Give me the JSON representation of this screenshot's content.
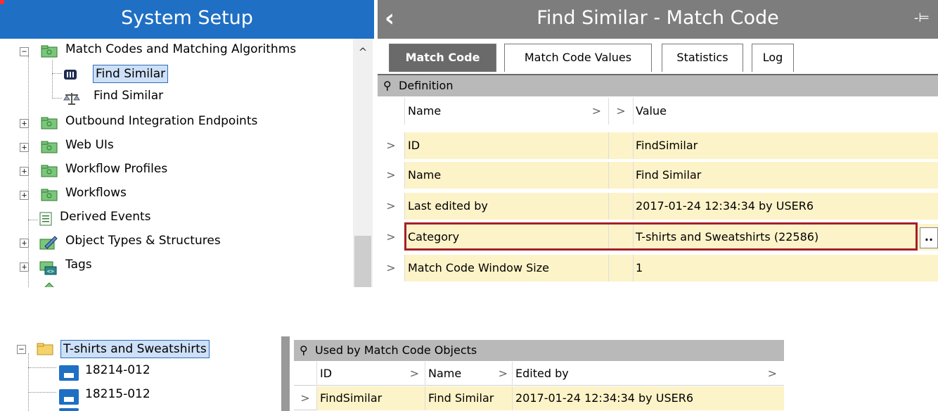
{
  "left_panel": {
    "title": "System Setup",
    "tree": [
      {
        "label": "Match Codes and Matching Algorithms",
        "icon": "folder-icon",
        "expander": "−"
      },
      {
        "label": "Find Similar",
        "icon": "match-code-icon",
        "selected": true
      },
      {
        "label": "Find Similar",
        "icon": "matching-algorithm-icon"
      },
      {
        "label": "Outbound Integration Endpoints",
        "icon": "folder-icon",
        "expander": "+"
      },
      {
        "label": "Web UIs",
        "icon": "folder-icon",
        "expander": "+"
      },
      {
        "label": "Workflow Profiles",
        "icon": "folder-icon",
        "expander": "+"
      },
      {
        "label": "Workflows",
        "icon": "folder-icon",
        "expander": "+"
      },
      {
        "label": "Derived Events",
        "icon": "document-icon"
      },
      {
        "label": "Object Types & Structures",
        "icon": "object-types-icon",
        "expander": "+"
      },
      {
        "label": "Tags",
        "icon": "tags-icon",
        "expander": "+"
      }
    ]
  },
  "right_panel": {
    "title": "Find Similar - Match Code",
    "tabs": [
      {
        "label": "Match Code",
        "active": true
      },
      {
        "label": "Match Code Values"
      },
      {
        "label": "Statistics"
      },
      {
        "label": "Log"
      }
    ],
    "section_title": "Definition",
    "columns": {
      "name": "Name",
      "value": "Value"
    },
    "rows": [
      {
        "name": "ID",
        "value": "FindSimilar"
      },
      {
        "name": "Name",
        "value": "Find Similar"
      },
      {
        "name": "Last edited by",
        "value": "2017-01-24 12:34:34 by USER6"
      },
      {
        "name": "Category",
        "value": "T-shirts and Sweatshirts (22586)"
      },
      {
        "name": "Match Code Window Size",
        "value": "1"
      }
    ],
    "ellipsis_label": ".."
  },
  "bottom_tree": {
    "root": "T-shirts and Sweatshirts",
    "children": [
      "18214-012",
      "18215-012"
    ]
  },
  "bottom_grid": {
    "section_title": "Used by Match Code Objects",
    "columns": {
      "id": "ID",
      "name": "Name",
      "edited_by": "Edited by"
    },
    "rows": [
      {
        "id": "FindSimilar",
        "name": "Find Similar",
        "edited_by": "2017-01-24 12:34:34 by USER6"
      }
    ]
  },
  "colors": {
    "header_blue": "#1f6fc4",
    "header_gray": "#7d7d7d",
    "row_yellow": "#fdf3c8",
    "highlight_red": "#a51f2a",
    "selection_blue": "#cde0f7"
  }
}
